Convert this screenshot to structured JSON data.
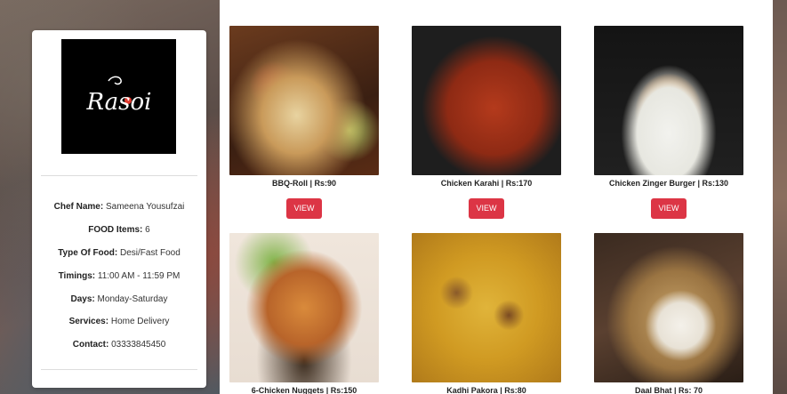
{
  "chef": {
    "logo_text": "Rasoi",
    "name_label": "Chef Name:",
    "name_value": "Sameena Yousufzai",
    "items_label": "FOOD Items:",
    "items_value": "6",
    "type_label": "Type Of Food:",
    "type_value": "Desi/Fast Food",
    "timings_label": "Timings:",
    "timings_value": "11:00 AM - 11:59 PM",
    "days_label": "Days:",
    "days_value": "Monday-Saturday",
    "services_label": "Services:",
    "services_value": "Home Delivery",
    "contact_label": "Contact:",
    "contact_value": "03333845450"
  },
  "menu": [
    {
      "caption": "BBQ-Roll | Rs:90",
      "button": "VIEW"
    },
    {
      "caption": "Chicken Karahi | Rs:170",
      "button": "VIEW"
    },
    {
      "caption": "Chicken Zinger Burger | Rs:130",
      "button": "VIEW"
    },
    {
      "caption": "6-Chicken Nuggets | Rs:150"
    },
    {
      "caption": "Kadhi Pakora | Rs:80"
    },
    {
      "caption": "Daal Bhat | Rs: 70"
    }
  ],
  "colors": {
    "view_button": "#dc3545",
    "logo_bg": "#000000"
  }
}
